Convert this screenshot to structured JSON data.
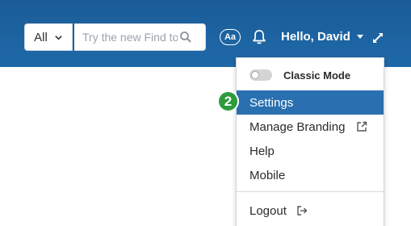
{
  "header": {
    "scope_select": {
      "value": "All"
    },
    "search": {
      "placeholder": "Try the new Find to"
    },
    "font_size_label": "Aa",
    "user_greeting": "Hello, David"
  },
  "dropdown": {
    "classic_mode_label": "Classic Mode",
    "classic_mode_enabled": false,
    "items": [
      {
        "label": "Settings",
        "active": true
      },
      {
        "label": "Manage Branding"
      },
      {
        "label": "Help"
      },
      {
        "label": "Mobile"
      }
    ],
    "logout_label": "Logout"
  },
  "annotation": {
    "step_number": "2",
    "color": "#2e9b3c"
  },
  "colors": {
    "header": "#1f69a8",
    "active_item": "#2a70b0"
  },
  "icons": [
    "chevron-down-icon",
    "search-icon",
    "font-size-icon",
    "bell-icon",
    "caret-down-icon",
    "expand-icon",
    "external-link-icon",
    "logout-icon"
  ]
}
